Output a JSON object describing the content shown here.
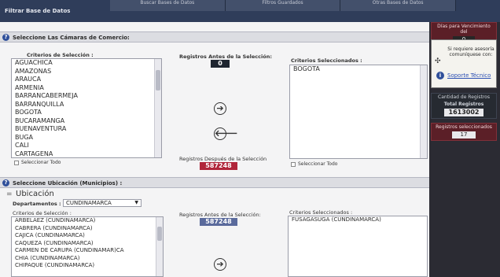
{
  "topbar": {
    "title": "Filtrar Base de Datos",
    "tabs": [
      "Buscar Bases de Datos",
      "Filtros Guardados",
      "Otras Bases de Datos"
    ]
  },
  "section1": {
    "header": "Seleccione Las Cámaras de Comercio:",
    "criteria_label": "Criterios de Selección :",
    "criteria_items": [
      "AGUACHICA",
      "AMAZONAS",
      "ARAUCA",
      "ARMENIA",
      "BARRANCABERMEJA",
      "BARRANQUILLA",
      "BOGOTA",
      "BUCARAMANGA",
      "BUENAVENTURA",
      "BUGA",
      "CALI",
      "CARTAGENA"
    ],
    "select_all_left": "Seleccionar Todo",
    "before_label": "Registros Antes de la Selección:",
    "before_value": "0",
    "after_label": "Registros Después de la Selección",
    "after_value": "587248",
    "selected_label": "Criterios Seleccionados :",
    "selected_items": [
      "BOGOTA"
    ],
    "select_all_right": "Seleccionar Todo",
    "add_symbol": "➔",
    "remove_symbol": "🡐"
  },
  "section2": {
    "header": "Seleccione Ubicación (Municipios) :",
    "subheader": "Ubicación",
    "dept_label": "Departamentos :",
    "dept_value": "CUNDINAMARCA",
    "criteria_label": "Criterios de Selección :",
    "criteria_items": [
      "ARBELAEZ (CUNDINAMARCA)",
      "CABRERA (CUNDINAMARCA)",
      "CAJICA (CUNDINAMARCA)",
      "CAQUEZA (CUNDINAMARCA)",
      "CARMEN DE CARUPA (CUNDINAMAR)CA",
      "CHIA (CUNDINAMARCA)",
      "CHIPAQUE (CUNDINAMARCA)"
    ],
    "before_label": "Registros Antes de la Selección:",
    "before_value": "587248",
    "selected_label": "Criterios Seleccionados :",
    "selected_items": [
      "FUSAGASUGA (CUNDINAMARCA)"
    ],
    "add_symbol": "➔"
  },
  "sidebar": {
    "days_label": "Días para Vencimiento del",
    "days_value": "0",
    "advice_text": "Si requiere asesoría comuníquese con:",
    "support_link": "Soporte Técnico",
    "count_label": "Cantidad de Registros",
    "total_label": "Total Registros",
    "total_value": "1613002",
    "selected_label": "Registros seleccionados",
    "selected_value": "17"
  },
  "colors": {
    "counter_dark": "#1e2530",
    "counter_red": "#b0263a",
    "counter_blue": "#5a6a9c"
  }
}
